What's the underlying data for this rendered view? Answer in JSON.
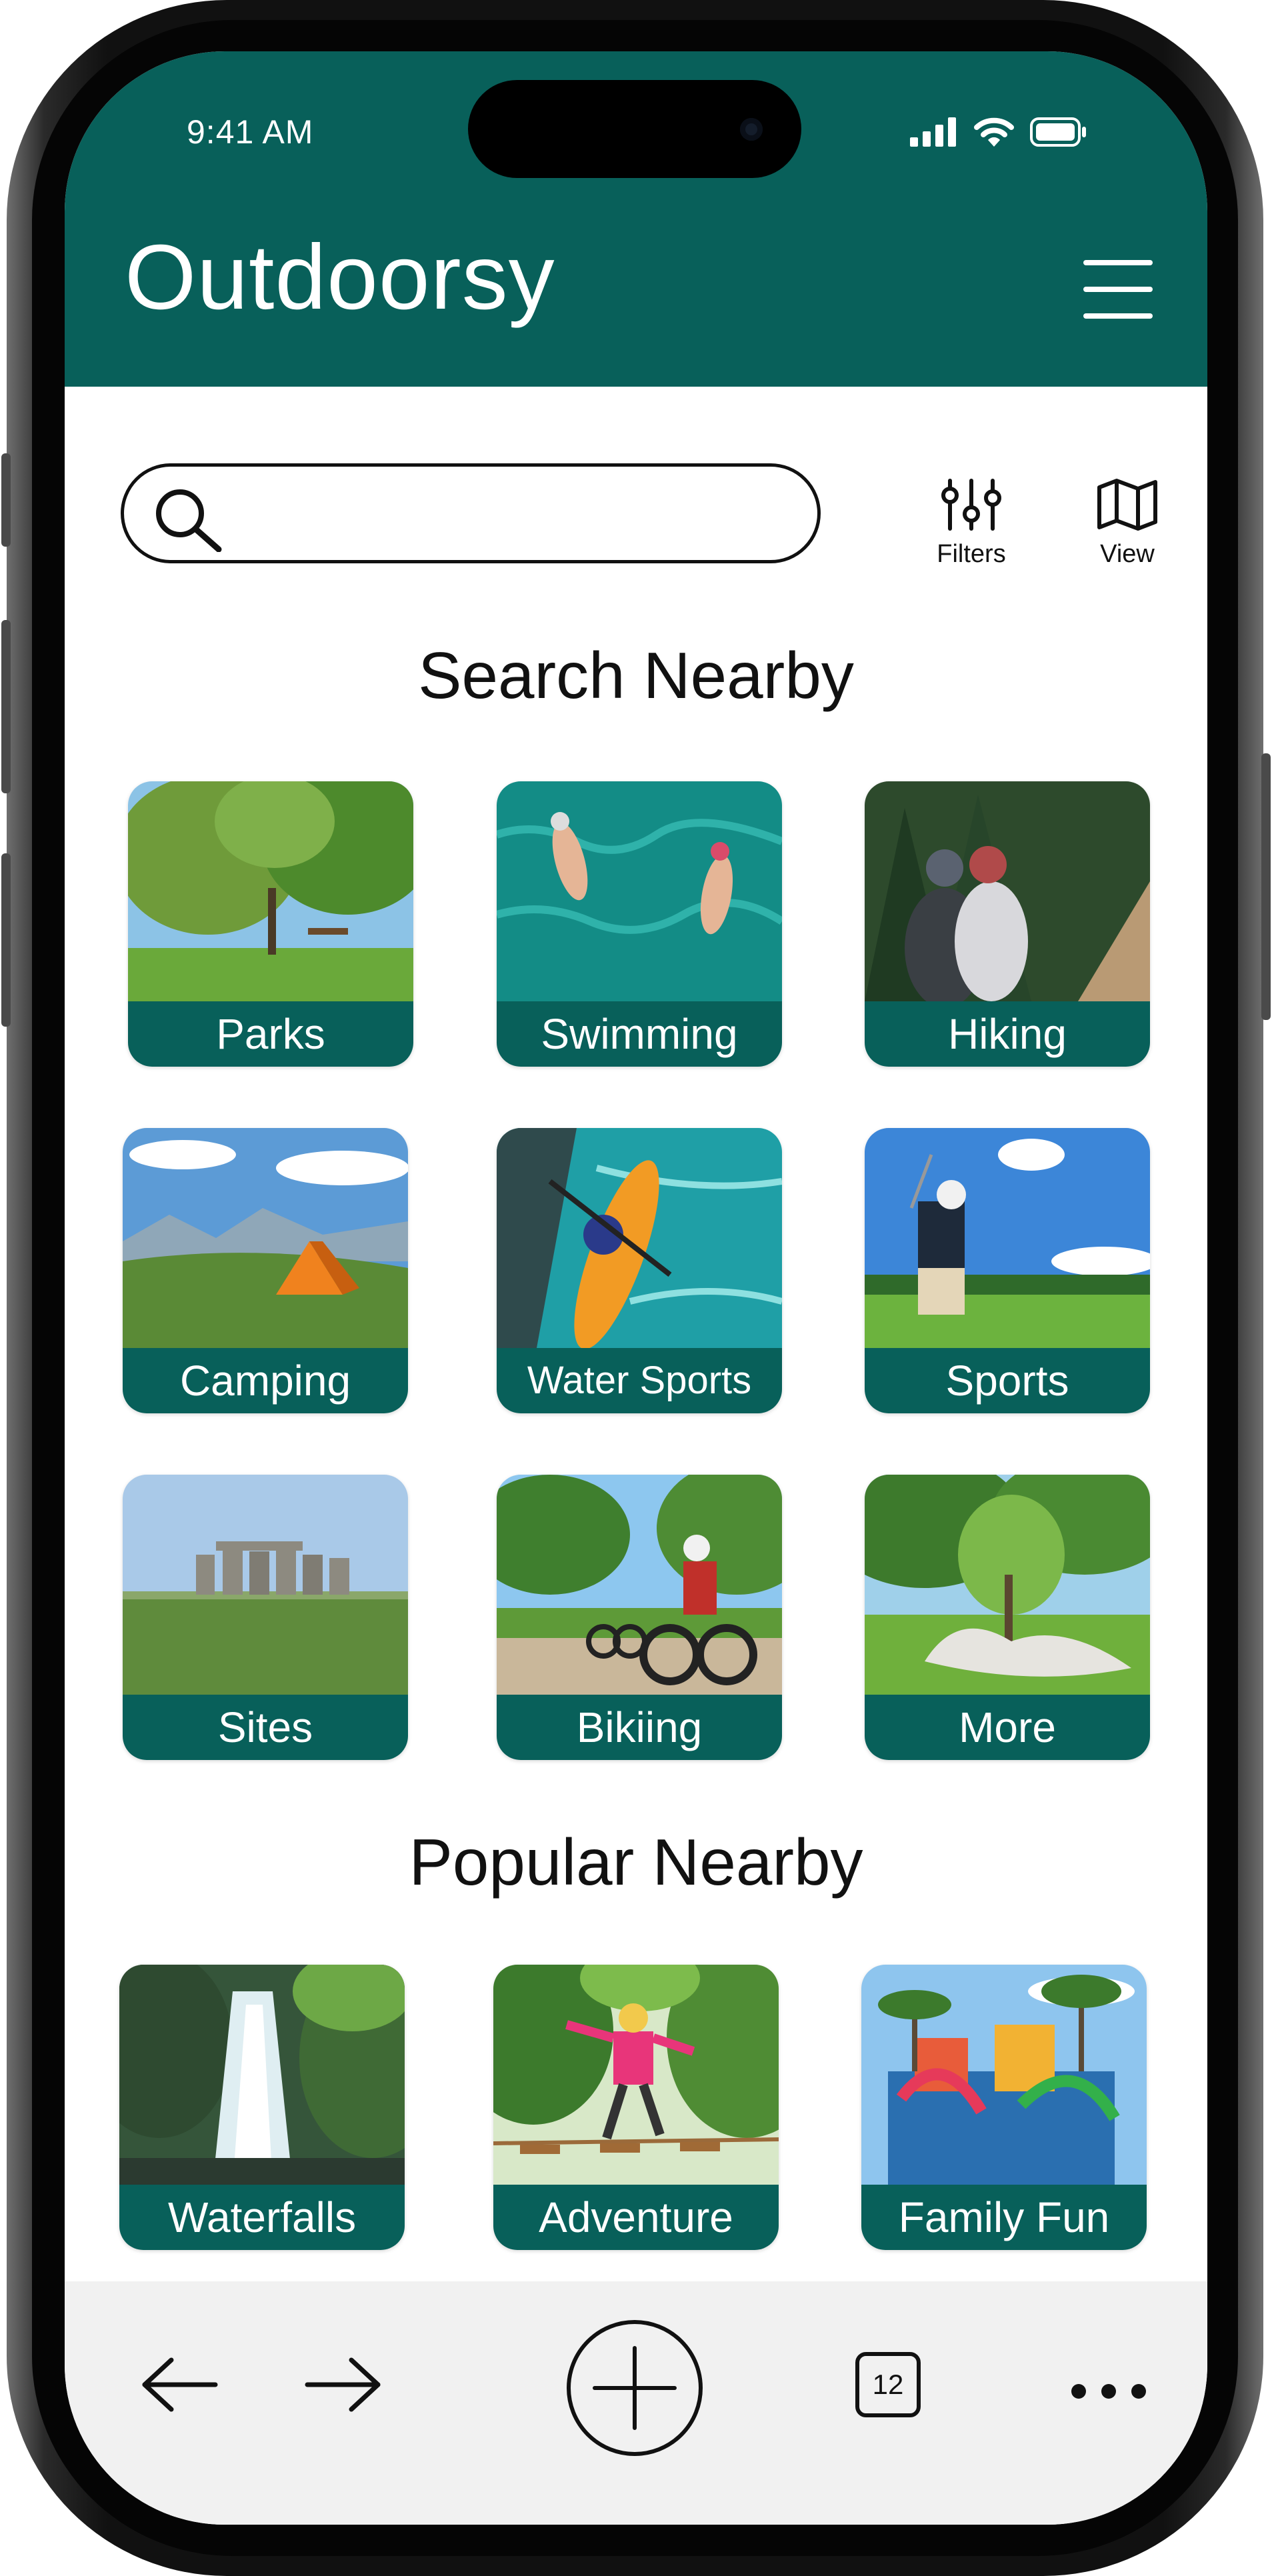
{
  "status_bar": {
    "time": "9:41 AM"
  },
  "header": {
    "title": "Outdoorsy",
    "menu_icon": "hamburger-menu-icon"
  },
  "search": {
    "value": "",
    "placeholder": "",
    "icon": "search-icon"
  },
  "toolbar": {
    "filters_label": "Filters",
    "view_label": "View"
  },
  "sections": {
    "search_nearby": {
      "title": "Search Nearby",
      "tiles": [
        {
          "label": "Parks"
        },
        {
          "label": "Swimming"
        },
        {
          "label": "Hiking"
        },
        {
          "label": "Camping"
        },
        {
          "label": "Water Sports"
        },
        {
          "label": "Sports"
        },
        {
          "label": "Sites"
        },
        {
          "label": "Bikiing"
        },
        {
          "label": "More"
        }
      ]
    },
    "popular_nearby": {
      "title": "Popular Nearby",
      "tiles": [
        {
          "label": "Waterfalls"
        },
        {
          "label": "Adventure"
        },
        {
          "label": "Family Fun"
        }
      ]
    }
  },
  "bottom_bar": {
    "tab_count": "12",
    "icons": [
      "back-arrow-icon",
      "forward-arrow-icon",
      "new-tab-plus-icon",
      "tabs-icon",
      "more-dots-icon"
    ]
  },
  "colors": {
    "brand": "#08605a",
    "background": "#ffffff",
    "bottom_bar": "#f1f1f1"
  }
}
